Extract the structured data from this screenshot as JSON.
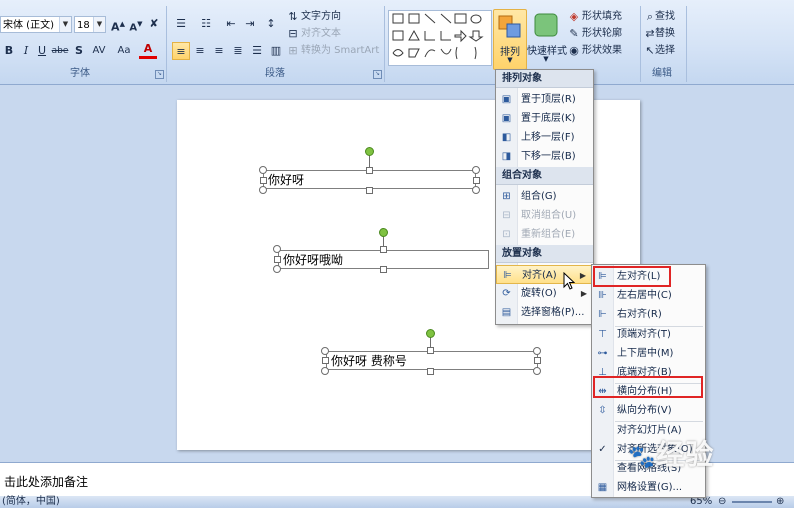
{
  "font_group": {
    "font_name": "宋体 (正文)",
    "font_size": "18",
    "label": "字体",
    "buttons": [
      "B",
      "I",
      "U",
      "abe",
      "S",
      "AV",
      "Aa",
      "A"
    ]
  },
  "paragraph_group": {
    "label": "段落",
    "text_direction": "文字方向",
    "align_text": "对齐文本",
    "convert_smartart": "转换为 SmartArt"
  },
  "drawing_group": {
    "arrange_label": "排列",
    "quick_styles_label": "快速样式",
    "shape_fill": "形状填充",
    "shape_outline": "形状轮廓",
    "shape_effects": "形状效果"
  },
  "editing_group": {
    "label": "编辑",
    "find": "查找",
    "replace": "替换",
    "select": "选择"
  },
  "slide": {
    "textboxes": [
      "你好呀",
      "你好呀哦呦",
      "你好呀 费称号"
    ]
  },
  "notes_placeholder": "击此处添加备注",
  "status": {
    "language": "(简体，中国)",
    "zoom": "65%"
  },
  "arrange_menu": {
    "section_order": "排列对象",
    "bring_front": "置于顶层(R)",
    "send_back": "置于底层(K)",
    "bring_forward": "上移一层(F)",
    "send_backward": "下移一层(B)",
    "section_group": "组合对象",
    "group": "组合(G)",
    "ungroup": "取消组合(U)",
    "regroup": "重新组合(E)",
    "section_position": "放置对象",
    "align": "对齐(A)",
    "rotate": "旋转(O)",
    "selection_pane": "选择窗格(P)..."
  },
  "align_menu": {
    "align_left": "左对齐(L)",
    "align_center": "左右居中(C)",
    "align_right": "右对齐(R)",
    "align_top": "顶端对齐(T)",
    "align_middle": "上下居中(M)",
    "align_bottom": "底端对齐(B)",
    "distribute_h": "横向分布(H)",
    "distribute_v": "纵向分布(V)",
    "align_to_slide": "对齐幻灯片(A)",
    "align_selected": "对齐所选对象(O)",
    "view_gridlines": "查看网格线(S)",
    "grid_settings": "网格设置(G)..."
  },
  "watermark": "经验"
}
